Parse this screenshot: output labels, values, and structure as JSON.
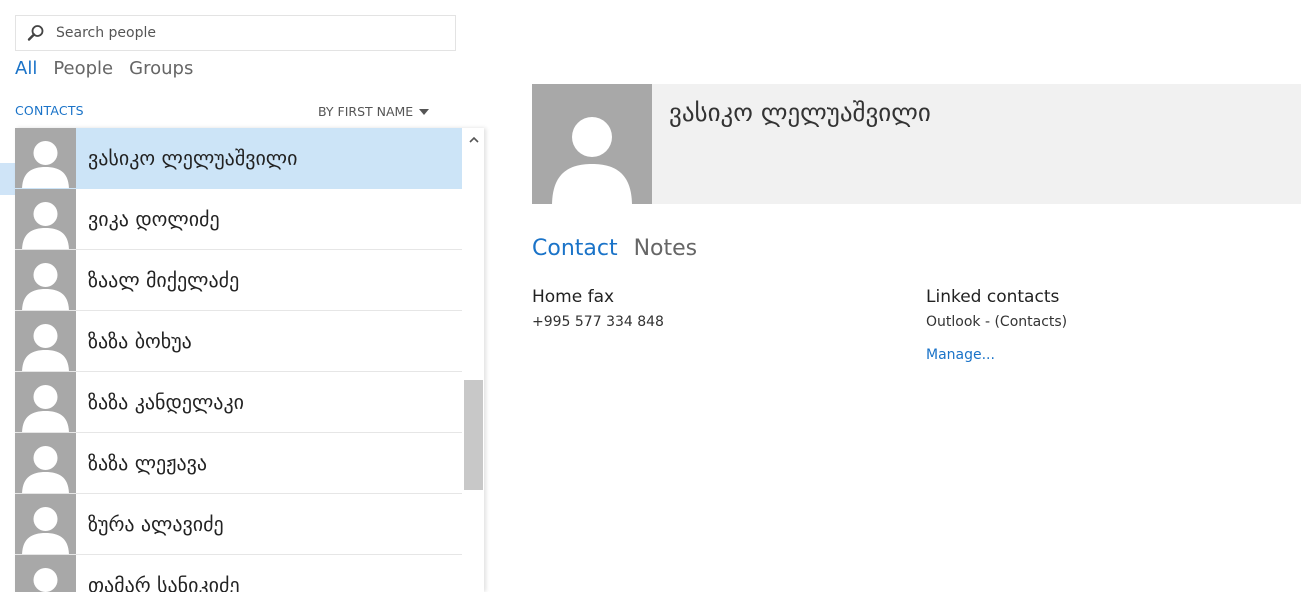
{
  "search": {
    "placeholder": "Search people",
    "icon": "search-icon"
  },
  "filters": [
    {
      "label": "All",
      "active": true
    },
    {
      "label": "People",
      "active": false
    },
    {
      "label": "Groups",
      "active": false
    }
  ],
  "list_header": {
    "section": "CONTACTS",
    "sort_label": "BY FIRST NAME"
  },
  "contacts": [
    {
      "name": "ვასიკო ლელუაშვილი",
      "selected": true
    },
    {
      "name": "ვიკა დოლიძე",
      "selected": false
    },
    {
      "name": "ზაალ მიქელაძე",
      "selected": false
    },
    {
      "name": "ზაზა ბოხუა",
      "selected": false
    },
    {
      "name": "ზაზა კანდელაკი",
      "selected": false
    },
    {
      "name": "ზაზა ლეჟავა",
      "selected": false
    },
    {
      "name": "ზურა ალავიძე",
      "selected": false
    },
    {
      "name": "თამარ სანიკიძე",
      "selected": false
    }
  ],
  "detail": {
    "name": "ვასიკო ლელუაშვილი",
    "tabs": [
      {
        "label": "Contact",
        "active": true
      },
      {
        "label": "Notes",
        "active": false
      }
    ],
    "home_fax_label": "Home fax",
    "home_fax_value": "+995 577 334 848",
    "linked_label": "Linked contacts",
    "linked_value": "Outlook - (Contacts)",
    "manage_link": "Manage..."
  },
  "colors": {
    "accent": "#1a73c8",
    "selected_row": "#cce4f7",
    "avatar": "#a8a8a8",
    "header_bg": "#f1f1f1"
  }
}
